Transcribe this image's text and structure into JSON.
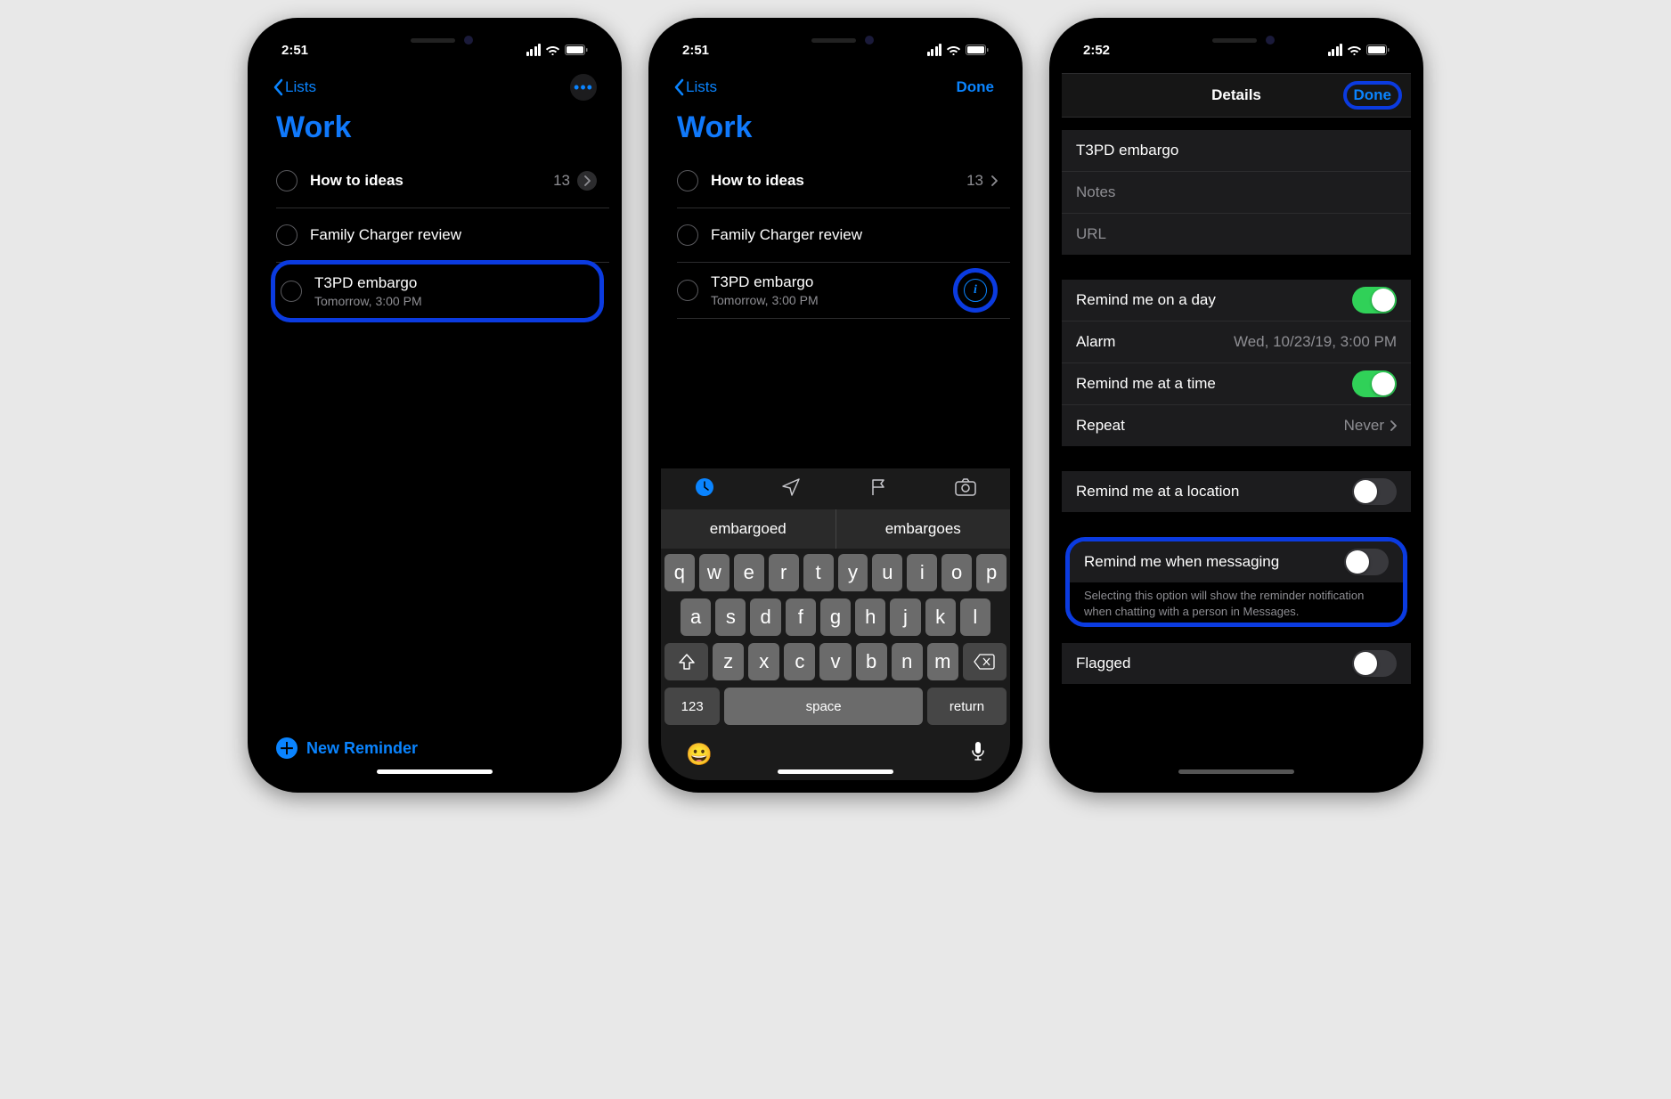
{
  "status": {
    "time_a": "2:51",
    "time_b": "2:51",
    "time_c": "2:52"
  },
  "nav": {
    "back_label": "Lists",
    "done_label": "Done",
    "details_title": "Details"
  },
  "list_title": "Work",
  "reminders": [
    {
      "title": "How to ideas",
      "count": "13"
    },
    {
      "title": "Family Charger review"
    },
    {
      "title": "T3PD embargo",
      "subtitle": "Tomorrow, 3:00 PM"
    }
  ],
  "new_reminder_label": "New Reminder",
  "keyboard": {
    "suggestions": [
      "embargoed",
      "embargoes"
    ],
    "rows": {
      "r1": [
        "q",
        "w",
        "e",
        "r",
        "t",
        "y",
        "u",
        "i",
        "o",
        "p"
      ],
      "r2": [
        "a",
        "s",
        "d",
        "f",
        "g",
        "h",
        "j",
        "k",
        "l"
      ],
      "r3": [
        "z",
        "x",
        "c",
        "v",
        "b",
        "n",
        "m"
      ]
    },
    "alt_key": "123",
    "space_key": "space",
    "return_key": "return"
  },
  "details": {
    "title_value": "T3PD embargo",
    "notes_placeholder": "Notes",
    "url_placeholder": "URL",
    "remind_day_label": "Remind me on a day",
    "alarm_label": "Alarm",
    "alarm_value": "Wed, 10/23/19, 3:00 PM",
    "remind_time_label": "Remind me at a time",
    "repeat_label": "Repeat",
    "repeat_value": "Never",
    "remind_location_label": "Remind me at a location",
    "remind_messaging_label": "Remind me when messaging",
    "remind_messaging_footer": "Selecting this option will show the reminder notification when chatting with a person in Messages.",
    "flagged_label": "Flagged"
  }
}
